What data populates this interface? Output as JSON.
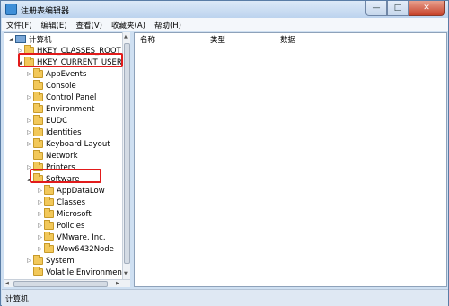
{
  "window": {
    "title": "注册表编辑器",
    "min": "—",
    "max": "□",
    "close": "✕"
  },
  "menu": [
    "文件(F)",
    "编辑(E)",
    "查看(V)",
    "收藏夹(A)",
    "帮助(H)"
  ],
  "tree": {
    "root": "计算机",
    "items": [
      "HKEY_CLASSES_ROOT",
      "HKEY_CURRENT_USER",
      "AppEvents",
      "Console",
      "Control Panel",
      "Environment",
      "EUDC",
      "Identities",
      "Keyboard Layout",
      "Network",
      "Printers",
      "Software",
      "AppDataLow",
      "Classes",
      "Microsoft",
      "Policies",
      "VMware, Inc.",
      "Wow6432Node",
      "System",
      "Volatile Environmen"
    ]
  },
  "list": {
    "columns": [
      "名称",
      "类型",
      "数据"
    ]
  },
  "status": "计算机",
  "colors": {
    "highlight": "#e21b1b",
    "folder": "#f2c85a"
  }
}
